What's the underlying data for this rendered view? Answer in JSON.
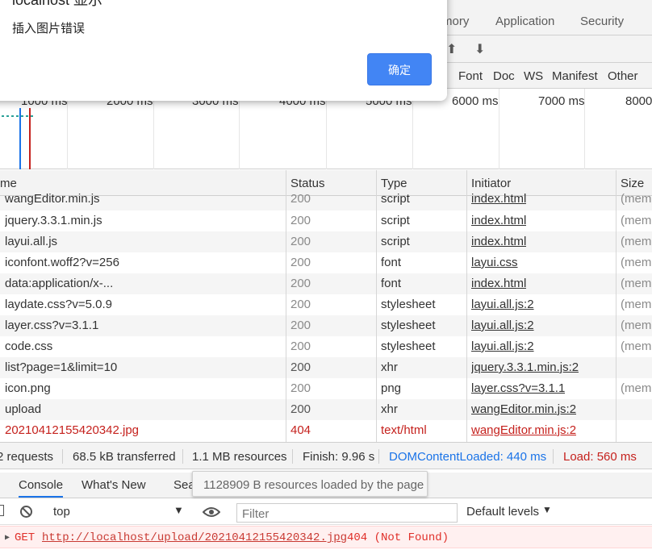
{
  "devtools_tabs": [
    "mory",
    "Application",
    "Security"
  ],
  "type_filters": [
    "Font",
    "Doc",
    "WS",
    "Manifest",
    "Other"
  ],
  "timeline_ticks": [
    "1000 ms",
    "2000 ms",
    "3000 ms",
    "4000 ms",
    "5000 ms",
    "6000 ms",
    "7000 ms",
    "8000"
  ],
  "columns": {
    "name": "me",
    "status": "Status",
    "type": "Type",
    "initiator": "Initiator",
    "size": "Size"
  },
  "rows": [
    {
      "name": "wangEditor.min.js",
      "status": "200",
      "type": "script",
      "initiator": "index.html",
      "size": "(mem"
    },
    {
      "name": "jquery.3.3.1.min.js",
      "status": "200",
      "type": "script",
      "initiator": "index.html",
      "size": "(mem"
    },
    {
      "name": "layui.all.js",
      "status": "200",
      "type": "script",
      "initiator": "index.html",
      "size": "(mem"
    },
    {
      "name": "iconfont.woff2?v=256",
      "status": "200",
      "type": "font",
      "initiator": "layui.css",
      "size": "(mem"
    },
    {
      "name": "data:application/x-...",
      "status": "200",
      "type": "font",
      "initiator": "index.html",
      "size": "(mem"
    },
    {
      "name": "laydate.css?v=5.0.9",
      "status": "200",
      "type": "stylesheet",
      "initiator": "layui.all.js:2",
      "size": "(mem"
    },
    {
      "name": "layer.css?v=3.1.1",
      "status": "200",
      "type": "stylesheet",
      "initiator": "layui.all.js:2",
      "size": "(mem"
    },
    {
      "name": "code.css",
      "status": "200",
      "type": "stylesheet",
      "initiator": "layui.all.js:2",
      "size": "(mem"
    },
    {
      "name": "list?page=1&limit=10",
      "status": "200",
      "type": "xhr",
      "initiator": "jquery.3.3.1.min.js:2",
      "size": ""
    },
    {
      "name": "icon.png",
      "status": "200",
      "type": "png",
      "initiator": "layer.css?v=3.1.1",
      "size": "(mem"
    },
    {
      "name": "upload",
      "status": "200",
      "type": "xhr",
      "initiator": "wangEditor.min.js:2",
      "size": ""
    },
    {
      "name": "20210412155420342.jpg",
      "status": "404",
      "type": "text/html",
      "initiator": "wangEditor.min.js:2",
      "size": ""
    }
  ],
  "summary": {
    "requests": "2 requests",
    "transferred": "68.5 kB transferred",
    "resources": "1.1 MB resources",
    "finish": "Finish: 9.96 s",
    "dcl": "DOMContentLoaded: 440 ms",
    "load": "Load: 560 ms"
  },
  "drawer": {
    "tab_console": "Console",
    "tab_whatsnew": "What's New",
    "tab_search": "Search",
    "tooltip": "1128909 B resources loaded by the page",
    "context": "top",
    "filter_placeholder": "Filter",
    "levels": "Default levels"
  },
  "log": {
    "method": "GET",
    "url": "http://localhost/upload/20210412155420342.jpg",
    "status": "404 (Not Found)"
  },
  "dialog": {
    "title": "localhost 显示",
    "message": "插入图片错误",
    "ok_label": "确定"
  },
  "colors": {
    "accent": "#4285f4",
    "error": "#c5211d",
    "dcl": "#1a73e8",
    "load": "#c5211d"
  }
}
